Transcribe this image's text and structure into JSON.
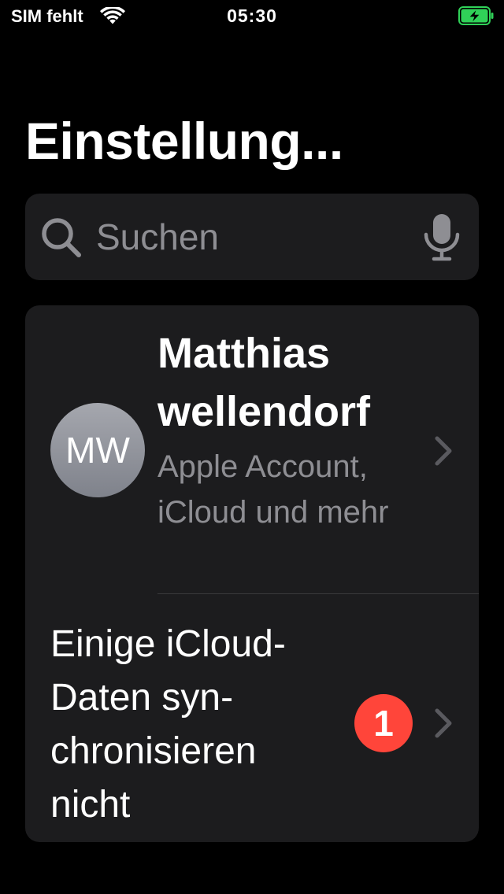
{
  "status_bar": {
    "carrier": "SIM fehlt",
    "time": "05:30",
    "battery_color": "#30d158"
  },
  "title": "Einstellung...",
  "search": {
    "placeholder": "Suchen"
  },
  "profile": {
    "initials": "MW",
    "name": "Matthias wellendorf",
    "subtitle": "Apple Account, iCloud und mehr"
  },
  "sync_row": {
    "label": "Einige iCloud-Daten syn­chronisieren nicht",
    "badge": "1"
  },
  "colors": {
    "background": "#000000",
    "cell": "#1c1c1e",
    "secondary_text": "#8e8e93",
    "badge": "#ff453a"
  }
}
